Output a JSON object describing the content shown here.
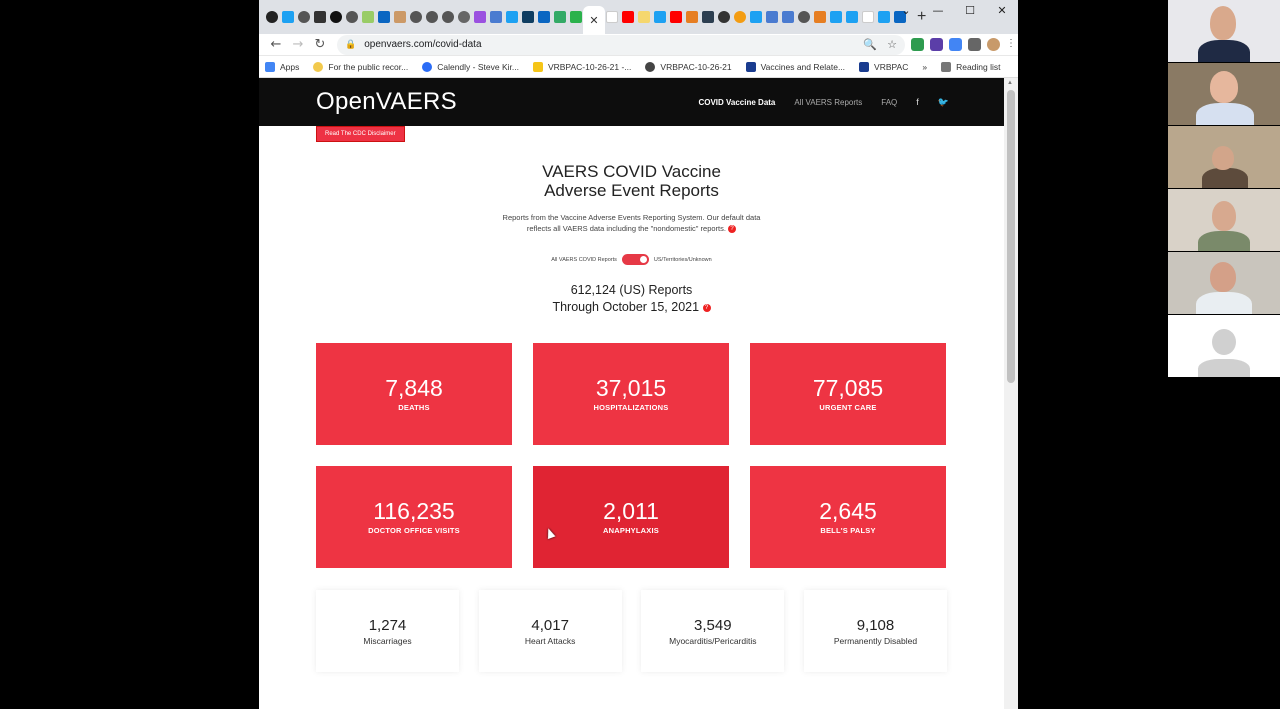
{
  "browser": {
    "url": "openvaers.com/covid-data",
    "window_controls": [
      "⌄",
      "—",
      "☐",
      "✕"
    ],
    "new_tab": "+",
    "bookmarks": [
      {
        "label": "Apps",
        "color": "#4285f4"
      },
      {
        "label": "For the public recor...",
        "color": "#f2c94c"
      },
      {
        "label": "Calendly - Steve Kir...",
        "color": "#2b6cf6"
      },
      {
        "label": "VRBPAC-10-26-21 -...",
        "color": "#f5c518"
      },
      {
        "label": "VRBPAC-10-26-21",
        "color": "#444444"
      },
      {
        "label": "Vaccines and Relate...",
        "color": "#1a3c8f"
      },
      {
        "label": "VRBPAC",
        "color": "#1a3c8f"
      }
    ],
    "bookmarks_more": "»",
    "reading_list": "Reading list"
  },
  "site": {
    "logo": "OpenVAERS",
    "nav": [
      {
        "label": "COVID Vaccine Data",
        "active": true
      },
      {
        "label": "All VAERS Reports",
        "active": false
      },
      {
        "label": "FAQ",
        "active": false
      }
    ],
    "social": [
      "f",
      "🐦"
    ],
    "disclaimer": "Read The CDC Disclaimer"
  },
  "hero": {
    "title_line1": "VAERS COVID Vaccine",
    "title_line2": "Adverse Event Reports",
    "desc_line1": "Reports from the Vaccine Adverse Events Reporting System. Our default data",
    "desc_line2": "reflects all VAERS data including the \"nondomestic\" reports.",
    "toggle_left": "All VAERS COVID Reports",
    "toggle_right": "US/Territories/Unknown",
    "reports_line1": "612,124 (US) Reports",
    "reports_line2": "Through October 15, 2021"
  },
  "cards": [
    {
      "value": "7,848",
      "label": "DEATHS"
    },
    {
      "value": "37,015",
      "label": "HOSPITALIZATIONS"
    },
    {
      "value": "77,085",
      "label": "URGENT CARE"
    },
    {
      "value": "116,235",
      "label": "DOCTOR OFFICE VISITS"
    },
    {
      "value": "2,011",
      "label": "ANAPHYLAXIS"
    },
    {
      "value": "2,645",
      "label": "BELL'S PALSY"
    }
  ],
  "small_cards": [
    {
      "value": "1,274",
      "label": "Miscarriages"
    },
    {
      "value": "4,017",
      "label": "Heart Attacks"
    },
    {
      "value": "3,549",
      "label": "Myocarditis/Pericarditis"
    },
    {
      "value": "9,108",
      "label": "Permanently Disabled"
    }
  ],
  "colors": {
    "accent_red": "#ee3443",
    "header_bg": "#0d0d0d"
  }
}
